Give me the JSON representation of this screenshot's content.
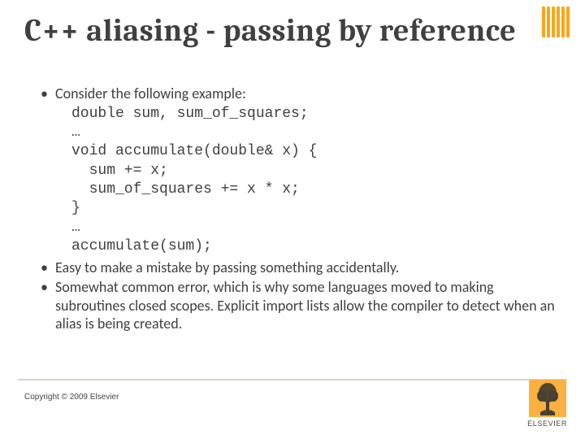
{
  "title": "C++ aliasing - passing by reference",
  "bullets": {
    "b1": "Consider the following example:",
    "b2": "Easy to make a mistake by passing something accidentally.",
    "b3": "Somewhat common error, which is why some languages moved to making subroutines closed scopes.  Explicit import lists allow the compiler to detect when an alias is being created."
  },
  "code": "double sum, sum_of_squares;\n…\nvoid accumulate(double& x) {\n  sum += x;\n  sum_of_squares += x * x;\n}\n…\naccumulate(sum);",
  "copyright": "Copyright © 2009 Elsevier",
  "logo": {
    "text": "ELSEVIER"
  }
}
